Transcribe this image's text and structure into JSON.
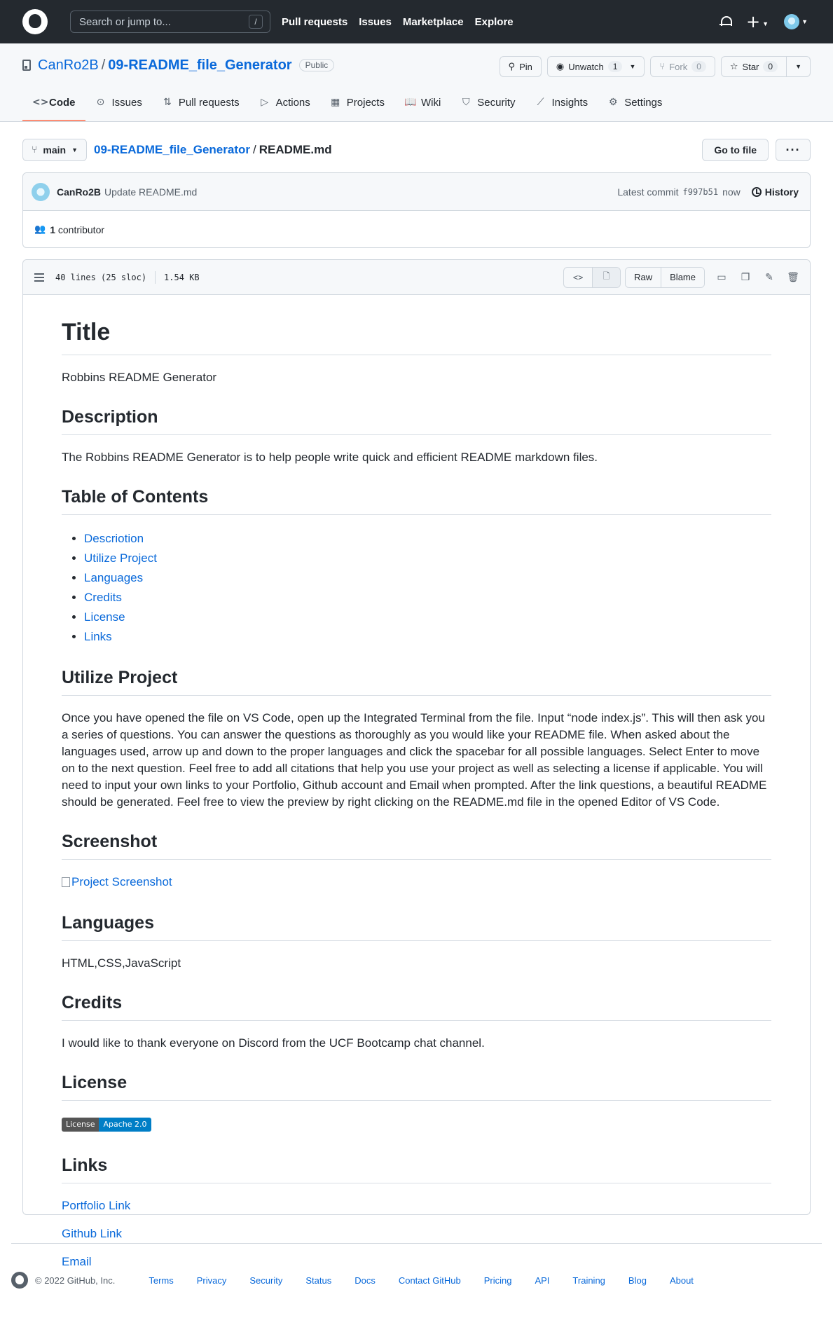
{
  "header": {
    "search_placeholder": "Search or jump to...",
    "search_shortcut": "/",
    "nav": [
      "Pull requests",
      "Issues",
      "Marketplace",
      "Explore"
    ]
  },
  "repo": {
    "owner": "CanRo2B",
    "separator": "/",
    "name": "09-README_file_Generator",
    "visibility": "Public",
    "pin_label": "Pin",
    "unwatch_label": "Unwatch",
    "watch_count": "1",
    "fork_label": "Fork",
    "fork_count": "0",
    "star_label": "Star",
    "star_count": "0"
  },
  "tabs": [
    {
      "label": "Code",
      "icon": "code-icon",
      "glyph": "<>"
    },
    {
      "label": "Issues",
      "icon": "issue-icon",
      "glyph": "⊙"
    },
    {
      "label": "Pull requests",
      "icon": "pull-request-icon",
      "glyph": "⇅"
    },
    {
      "label": "Actions",
      "icon": "play-icon",
      "glyph": "▷"
    },
    {
      "label": "Projects",
      "icon": "table-icon",
      "glyph": "▦"
    },
    {
      "label": "Wiki",
      "icon": "book-icon",
      "glyph": "📖"
    },
    {
      "label": "Security",
      "icon": "shield-icon",
      "glyph": "⛉"
    },
    {
      "label": "Insights",
      "icon": "graph-icon",
      "glyph": "⟋"
    },
    {
      "label": "Settings",
      "icon": "gear-icon",
      "glyph": "⚙"
    }
  ],
  "filenav": {
    "branch": "main",
    "repo_link": "09-README_file_Generator",
    "separator": "/",
    "file": "README.md",
    "goto_label": "Go to file",
    "more_label": "···"
  },
  "commit": {
    "author": "CanRo2B",
    "message": "Update README.md",
    "latest_label": "Latest commit",
    "sha": "f997b51",
    "time": "now",
    "history_label": "History",
    "contributor_count": "1",
    "contributor_label": "contributor"
  },
  "file": {
    "lines": "40 lines (25 sloc)",
    "size": "1.54 KB",
    "raw_label": "Raw",
    "blame_label": "Blame"
  },
  "readme": {
    "title": "Title",
    "title_text": "Robbins README Generator",
    "description_heading": "Description",
    "description_text": "The Robbins README Generator is to help people write quick and efficient README markdown files.",
    "toc_heading": "Table of Contents",
    "toc": [
      "Descriotion",
      "Utilize Project",
      "Languages",
      "Credits",
      "License",
      "Links"
    ],
    "utilize_heading": "Utilize Project",
    "utilize_text": "Once you have opened the file on VS Code, open up the Integrated Terminal from the file. Input “node index.js”. This will then ask you a series of questions. You can answer the questions as thoroughly as you would like your README file. When asked about the languages used, arrow up and down to the proper languages and click the spacebar for all possible languages. Select Enter to move on to the next question. Feel free to add all citations that help you use your project as well as selecting a license if applicable. You will need to input your own links to your Portfolio, Github account and Email when prompted. After the link questions, a beautiful README should be generated. Feel free to view the preview by right clicking on the README.md file in the opened Editor of VS Code.",
    "screenshot_heading": "Screenshot",
    "screenshot_alt": "Project Screenshot",
    "languages_heading": "Languages",
    "languages_text": "HTML,CSS,JavaScript",
    "credits_heading": "Credits",
    "credits_text": "I would like to thank everyone on Discord from the UCF Bootcamp chat channel.",
    "license_heading": "License",
    "license_badge_left": "License",
    "license_badge_right": "Apache 2.0",
    "links_heading": "Links",
    "links": [
      "Portfolio Link",
      "Github Link",
      "Email"
    ]
  },
  "footer": {
    "copyright": "© 2022 GitHub, Inc.",
    "links": [
      "Terms",
      "Privacy",
      "Security",
      "Status",
      "Docs",
      "Contact GitHub",
      "Pricing",
      "API",
      "Training",
      "Blog",
      "About"
    ]
  }
}
